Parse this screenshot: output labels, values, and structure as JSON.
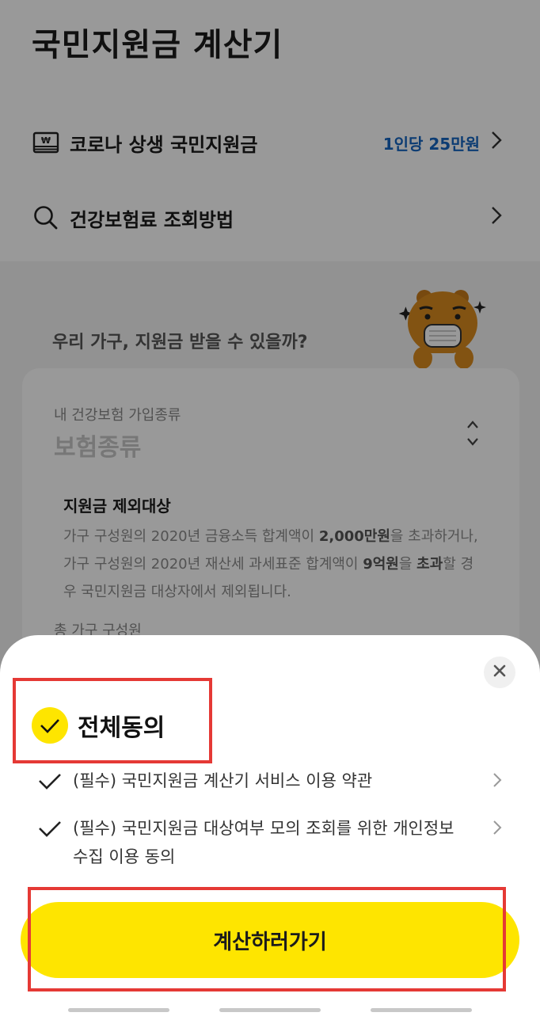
{
  "header": {
    "title": "국민지원금 계산기"
  },
  "menu": [
    {
      "label": "코로나 상생 국민지원금",
      "value": "1인당 25만원",
      "icon": "won-card-icon"
    },
    {
      "label": "건강보험료 조회방법",
      "value": "",
      "icon": "search-icon"
    }
  ],
  "form": {
    "question": "우리 가구, 지원금 받을 수 있을까?",
    "insurance_label": "내 건강보험 가입종류",
    "insurance_placeholder": "보험종류",
    "members_label": "총 가구 구성원"
  },
  "tooltip": {
    "title": "지원금 제외대상",
    "body_1": "가구 구성원의 2020년 금융소득 합계액이 ",
    "body_bold_1": "2,000만원",
    "body_2": "을 초과하거나, 가구 구성원의 2020년 재산세 과세표준 합계액이 ",
    "body_bold_2": "9억원",
    "body_3": "을 ",
    "body_bold_3": "초과",
    "body_4": "할 경우 국민지원금 대상자에서 제외됩니다."
  },
  "sheet": {
    "agree_all": "전체동의",
    "terms": [
      {
        "text": "(필수) 국민지원금 계산기 서비스 이용 약관"
      },
      {
        "text": "(필수) 국민지원금 대상여부 모의 조회를 위한 개인정보 수집 이용 동의"
      }
    ],
    "cta": "계산하러가기"
  },
  "colors": {
    "accent": "#fee500",
    "link": "#1565c0",
    "highlight": "#e53935"
  }
}
